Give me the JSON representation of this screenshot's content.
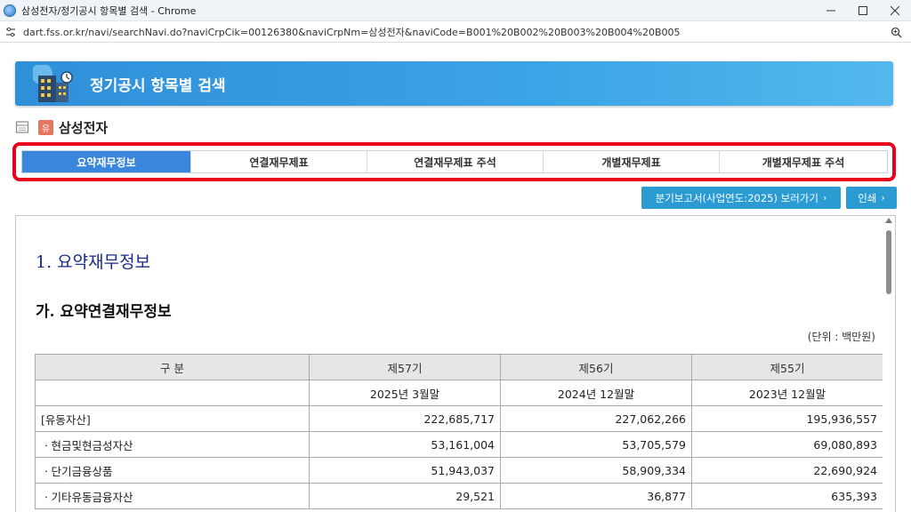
{
  "window": {
    "title": "삼성전자/정기공시 항목별 검색 - Chrome",
    "url": "dart.fss.or.kr/navi/searchNavi.do?naviCrpCik=00126380&naviCrpNm=삼성전자&naviCode=B001%20B002%20B003%20B004%20B005"
  },
  "banner": {
    "title": "정기공시 항목별 검색"
  },
  "company": {
    "badge": "유",
    "name": "삼성전자"
  },
  "tabs": [
    {
      "label": "요약재무정보",
      "active": true
    },
    {
      "label": "연결재무제표",
      "active": false
    },
    {
      "label": "연결재무제표 주석",
      "active": false
    },
    {
      "label": "개별재무제표",
      "active": false
    },
    {
      "label": "개별재무제표 주석",
      "active": false
    }
  ],
  "actions": {
    "report_button": "분기보고서(사업연도:2025) 보러가기",
    "print_button": "인쇄"
  },
  "document": {
    "heading": "1. 요약재무정보",
    "subheading": "가. 요약연결재무정보",
    "unit": "(단위 : 백만원)",
    "table": {
      "header": [
        "구 분",
        "제57기",
        "제56기",
        "제55기"
      ],
      "dates": [
        "",
        "2025년 3월말",
        "2024년 12월말",
        "2023년 12월말"
      ],
      "rows": [
        [
          "[유동자산]",
          "222,685,717",
          "227,062,266",
          "195,936,557"
        ],
        [
          "ㆍ현금및현금성자산",
          "53,161,004",
          "53,705,579",
          "69,080,893"
        ],
        [
          "ㆍ단기금융상품",
          "51,943,037",
          "58,909,334",
          "22,690,924"
        ],
        [
          "ㆍ기타유동금융자산",
          "29,521",
          "36,877",
          "635,393"
        ]
      ]
    }
  },
  "colors": {
    "banner": "#3ba4e6",
    "active_tab": "#3a86dc",
    "highlight": "#e8001c",
    "heading": "#1a2b8c",
    "button": "#2a9bd3"
  },
  "icons": {
    "window": "chrome-app-icon",
    "site": "site-settings-icon",
    "zoom": "zoom-icon",
    "banner": "building-icon",
    "company": "document-icon"
  }
}
